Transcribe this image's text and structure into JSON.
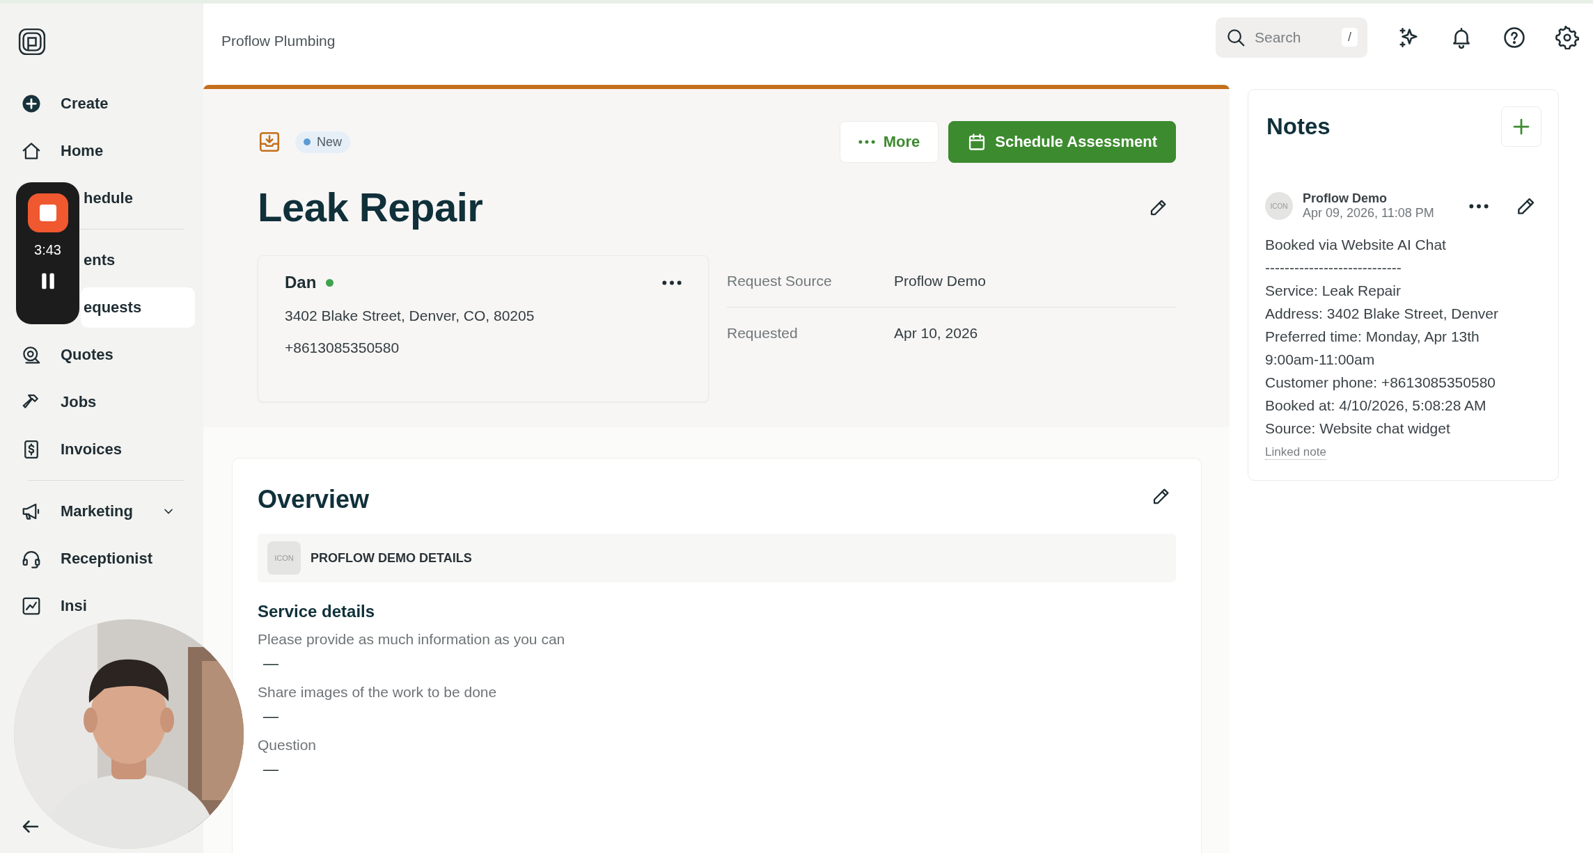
{
  "header": {
    "breadcrumb": "Proflow Plumbing",
    "search": {
      "placeholder": "Search",
      "shortcut": "/"
    }
  },
  "sidebar": {
    "sections": [
      {
        "items": [
          {
            "label": "Create",
            "kind": "link",
            "selected": false,
            "icon_hidden": false
          },
          {
            "label": "Home",
            "kind": "link",
            "selected": false,
            "icon_hidden": false
          },
          {
            "label": "hedule",
            "kind": "link",
            "selected": false,
            "icon_hidden": true
          }
        ]
      },
      {
        "items": [
          {
            "label": "ents",
            "kind": "link",
            "selected": false,
            "icon_hidden": true
          },
          {
            "label": "equests",
            "kind": "link",
            "selected": true,
            "icon_hidden": true
          },
          {
            "label": "Quotes",
            "kind": "link",
            "selected": false,
            "icon_hidden": false
          },
          {
            "label": "Jobs",
            "kind": "link",
            "selected": false,
            "icon_hidden": false
          },
          {
            "label": "Invoices",
            "kind": "link",
            "selected": false,
            "icon_hidden": false
          }
        ]
      },
      {
        "items": [
          {
            "label": "Marketing",
            "kind": "group",
            "selected": false,
            "icon_hidden": false
          },
          {
            "label": "Receptionist",
            "kind": "link",
            "selected": false,
            "icon_hidden": false
          },
          {
            "label": "Insi",
            "kind": "link",
            "selected": false,
            "icon_hidden": false
          }
        ]
      }
    ]
  },
  "request": {
    "status": {
      "label": "New",
      "color": "#5b9bd5"
    },
    "title": "Leak Repair",
    "actions": [
      {
        "label": "More",
        "kind": "secondary"
      },
      {
        "label": "Schedule Assessment",
        "kind": "primary"
      }
    ],
    "client": {
      "name": "Dan",
      "online": true,
      "address": "3402 Blake Street, Denver, CO, 80205",
      "phone": "+8613085350580"
    },
    "details": [
      {
        "label": "Request Source",
        "value": "Proflow Demo"
      },
      {
        "label": "Requested",
        "value": "Apr 10, 2026"
      }
    ]
  },
  "overview": {
    "title": "Overview",
    "section": {
      "icon_text": "ICON",
      "title": "PROFLOW DEMO DETAILS"
    },
    "subtitle": "Service details",
    "fields": [
      {
        "label": "Please provide as much information as you can",
        "value": "—"
      },
      {
        "label": "Share images of the work to be done",
        "value": "—"
      },
      {
        "label": "Question",
        "value": "—"
      }
    ]
  },
  "notes": {
    "title": "Notes",
    "items": [
      {
        "author": "Proflow Demo",
        "time": "Apr 09, 2026, 11:08 PM",
        "avatar_text": "ICON",
        "lines": [
          "Booked via Website AI Chat",
          "----------------------------",
          "Service: Leak Repair",
          "Address: 3402 Blake Street, Denver",
          "Preferred time: Monday, Apr 13th",
          "9:00am-11:00am",
          "Customer phone: +8613085350580",
          "Booked at: 4/10/2026, 5:08:28 AM",
          "Source: Website chat widget"
        ],
        "footer": "Linked note"
      }
    ]
  },
  "recorder": {
    "time": "3:43"
  }
}
